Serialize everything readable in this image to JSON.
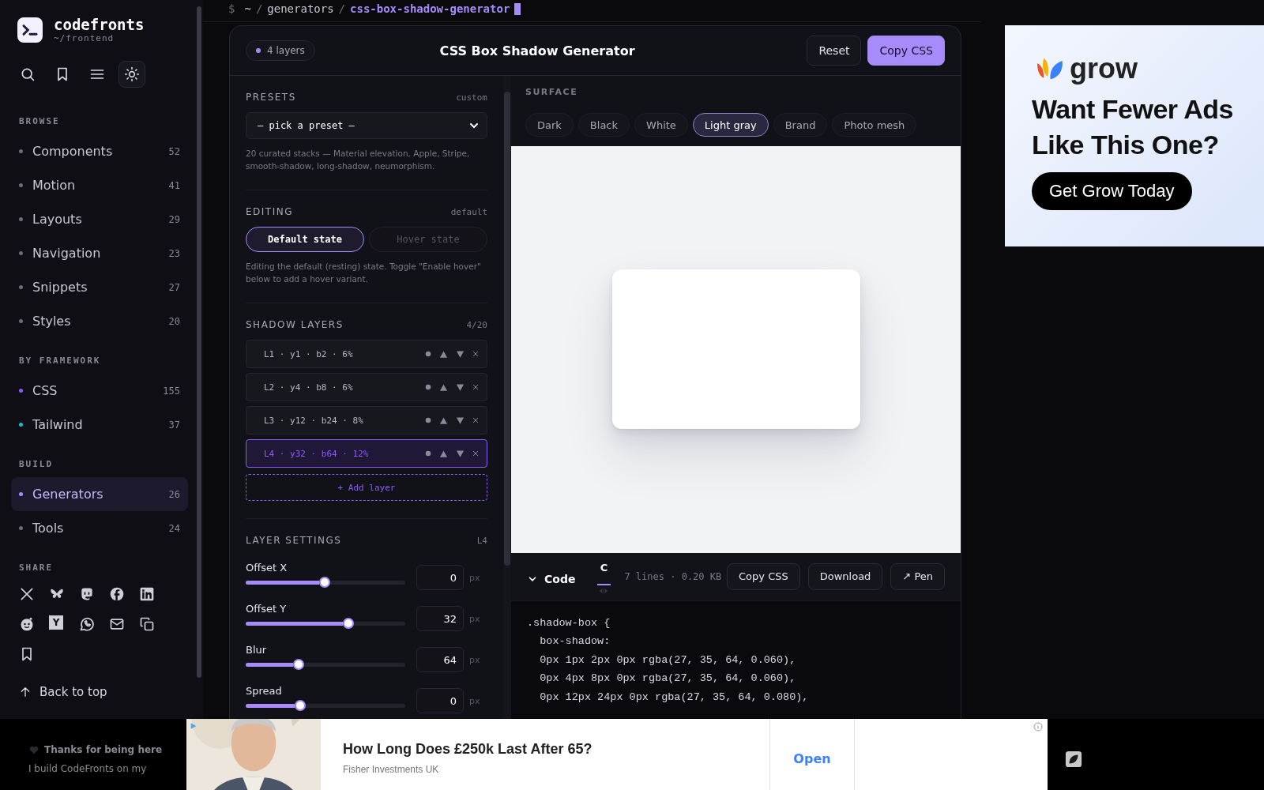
{
  "breadcrumb": {
    "prompt": "$",
    "separator": "/",
    "path": [
      "~",
      "generators"
    ],
    "current": "css-box-shadow-generator"
  },
  "sidebar": {
    "logo": {
      "name": "codefronts",
      "path": "~/frontend"
    },
    "toolbar": [
      {
        "kind": "search",
        "selected": false
      },
      {
        "kind": "bookmark",
        "selected": false
      },
      {
        "kind": "menu",
        "selected": false
      },
      {
        "kind": "sun",
        "selected": true
      }
    ],
    "sections": [
      {
        "title": "BROWSE",
        "items": [
          {
            "label": "Components",
            "count": "52",
            "color": "#6b6b7a",
            "selected": false
          },
          {
            "label": "Motion",
            "count": "41",
            "color": "#6b6b7a",
            "selected": false
          },
          {
            "label": "Layouts",
            "count": "29",
            "color": "#6b6b7a",
            "selected": false
          },
          {
            "label": "Navigation",
            "count": "23",
            "color": "#6b6b7a",
            "selected": false
          },
          {
            "label": "Snippets",
            "count": "27",
            "color": "#6b6b7a",
            "selected": false
          },
          {
            "label": "Styles",
            "count": "20",
            "color": "#6b6b7a",
            "selected": false
          }
        ]
      },
      {
        "title": "BY FRAMEWORK",
        "items": [
          {
            "label": "CSS",
            "count": "155",
            "color": "#8b5cf6",
            "selected": false
          },
          {
            "label": "Tailwind",
            "count": "37",
            "color": "#22b8cf",
            "selected": false
          }
        ]
      },
      {
        "title": "BUILD",
        "items": [
          {
            "label": "Generators",
            "count": "26",
            "color": "#a78bfa",
            "selected": true
          },
          {
            "label": "Tools",
            "count": "24",
            "color": "#6b6b7a",
            "selected": false
          }
        ]
      }
    ],
    "share": {
      "title": "SHARE",
      "icons": [
        {
          "kind": "x"
        },
        {
          "kind": "butterfly"
        },
        {
          "kind": "mastodon"
        },
        {
          "kind": "facebook"
        },
        {
          "kind": "linkedin"
        },
        {
          "kind": "reddit"
        },
        {
          "kind": "letter",
          "text": "Y"
        },
        {
          "kind": "whatsapp"
        },
        {
          "kind": "mail"
        },
        {
          "kind": "copy"
        },
        {
          "kind": "bookmark"
        }
      ]
    },
    "back_to_top": "Back to top"
  },
  "header": {
    "badge": "4 layers",
    "title": "CSS Box Shadow Generator",
    "buttons": [
      {
        "label": "Reset",
        "kind": "secondary"
      },
      {
        "label": "Copy CSS",
        "kind": "primary"
      }
    ]
  },
  "presets": {
    "title": "PRESETS",
    "value": "custom",
    "select": "– pick a preset –",
    "help": "20 curated stacks — Material elevation, Apple, Stripe, smooth-shadow, long-shadow, neumorphism."
  },
  "editing": {
    "title": "EDITING",
    "value": "default",
    "states": [
      {
        "label": "Default state",
        "selected": true
      },
      {
        "label": "Hover state",
        "selected": false
      }
    ],
    "help": "Editing the default (resting) state. Toggle \"Enable hover\" below to add a hover variant."
  },
  "layers": {
    "title": "SHADOW LAYERS",
    "count": "4/20",
    "add": "+ Add layer",
    "items": [
      {
        "label": "L1 · y1 · b2 · 6%",
        "selected": false
      },
      {
        "label": "L2 · y4 · b8 · 6%",
        "selected": false
      },
      {
        "label": "L3 · y12 · b24 · 8%",
        "selected": false
      },
      {
        "label": "L4 · y32 · b64 · 12%",
        "selected": true
      }
    ]
  },
  "layer_settings": {
    "title": "LAYER SETTINGS",
    "value": "L4",
    "sliders": [
      {
        "label": "Offset X",
        "level": 0.5,
        "value": "0",
        "unit": "px"
      },
      {
        "label": "Offset Y",
        "level": 0.65,
        "value": "32",
        "unit": "px"
      },
      {
        "label": "Blur",
        "level": 0.335,
        "value": "64",
        "unit": "px"
      },
      {
        "label": "Spread",
        "level": 0.345,
        "value": "0",
        "unit": "px"
      }
    ]
  },
  "surface": {
    "title": "SURFACE",
    "options": [
      {
        "label": "Dark",
        "selected": false
      },
      {
        "label": "Black",
        "selected": false
      },
      {
        "label": "White",
        "selected": false
      },
      {
        "label": "Light gray",
        "selected": true
      },
      {
        "label": "Brand",
        "selected": false
      },
      {
        "label": "Photo mesh",
        "selected": false
      }
    ]
  },
  "code": {
    "title": "Code",
    "expanded": true,
    "tabs": [
      {
        "label": "C",
        "selected": true
      }
    ],
    "stats": "7 lines · 0.20 KB",
    "buttons": [
      "Copy CSS",
      "Download",
      "↗ Pen"
    ],
    "lines": [
      ".shadow-box {",
      "  box-shadow:",
      "  0px 1px 2px 0px rgba(27, 35, 64, 0.060),",
      "  0px 4px 8px 0px rgba(27, 35, 64, 0.060),",
      "  0px 12px 24px 0px rgba(27, 35, 64, 0.080),"
    ]
  },
  "side_ad": {
    "brand": "grow",
    "headline": "Want Fewer Ads Like This One?",
    "button": "Get Grow Today"
  },
  "footer_note": {
    "title": "Thanks for being here",
    "text": "I build CodeFronts on my"
  },
  "bottom_ad": {
    "headline": "How Long Does £250k Last After 65?",
    "advertiser": "Fisher Investments UK",
    "action": "Open"
  }
}
